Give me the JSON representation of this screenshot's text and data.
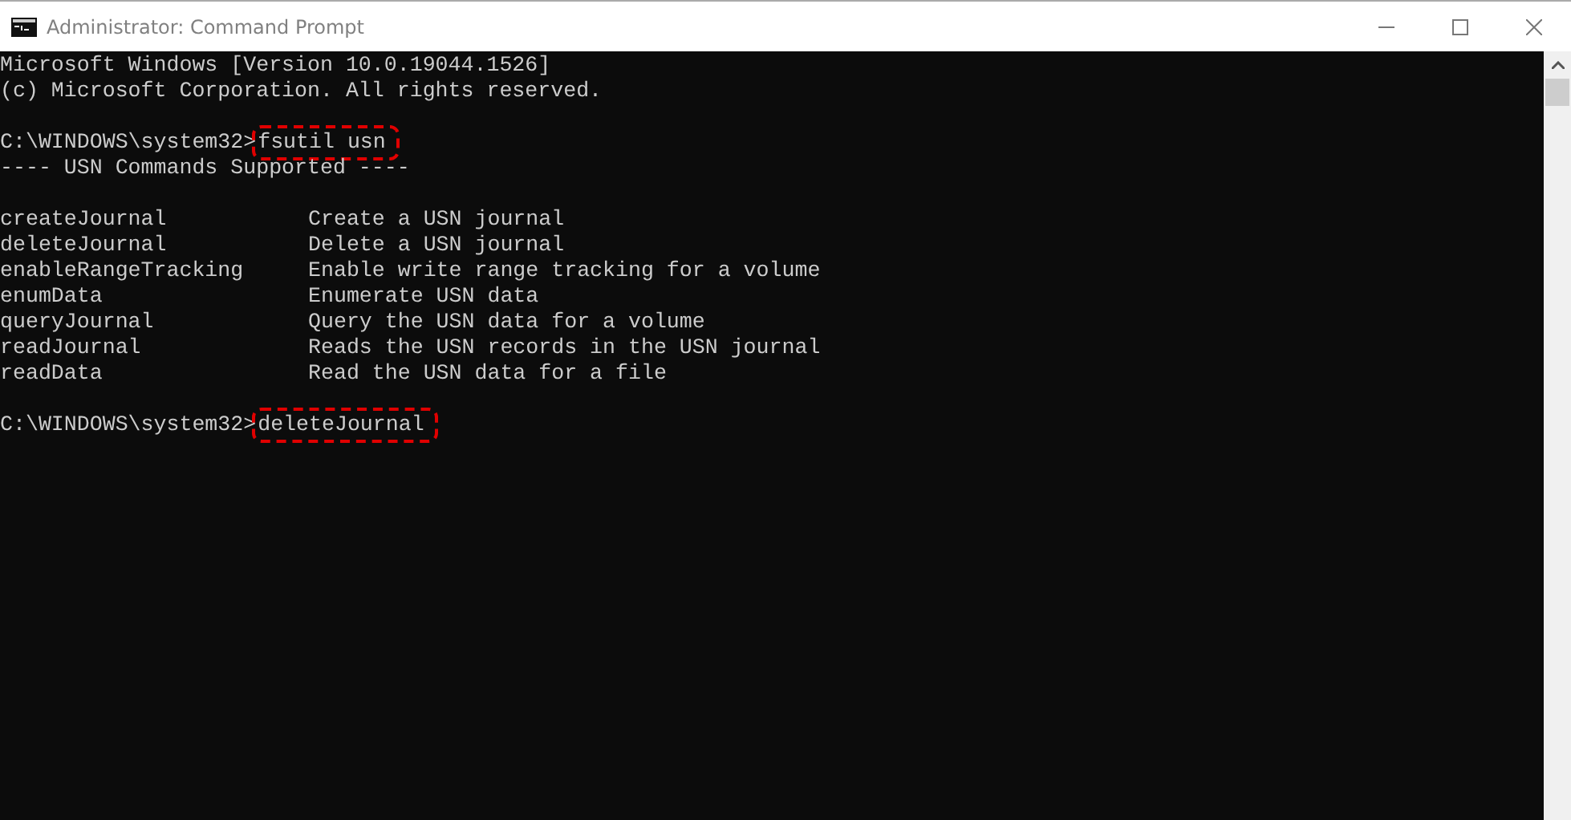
{
  "window": {
    "title": "Administrator: Command Prompt"
  },
  "console": {
    "lines": [
      {
        "kind": "text",
        "text": "Microsoft Windows [Version 10.0.19044.1526]"
      },
      {
        "kind": "text",
        "text": "(c) Microsoft Corporation. All rights reserved."
      },
      {
        "kind": "blank"
      },
      {
        "kind": "prompt",
        "prompt": "C:\\WINDOWS\\system32>",
        "command": "fsutil usn",
        "highlighted": true
      },
      {
        "kind": "text",
        "text": "---- USN Commands Supported ----"
      },
      {
        "kind": "blank"
      },
      {
        "kind": "row",
        "name": "createJournal",
        "description": "Create a USN journal"
      },
      {
        "kind": "row",
        "name": "deleteJournal",
        "description": "Delete a USN journal"
      },
      {
        "kind": "row",
        "name": "enableRangeTracking",
        "description": "Enable write range tracking for a volume"
      },
      {
        "kind": "row",
        "name": "enumData",
        "description": "Enumerate USN data"
      },
      {
        "kind": "row",
        "name": "queryJournal",
        "description": "Query the USN data for a volume"
      },
      {
        "kind": "row",
        "name": "readJournal",
        "description": "Reads the USN records in the USN journal"
      },
      {
        "kind": "row",
        "name": "readData",
        "description": "Read the USN data for a file"
      },
      {
        "kind": "blank"
      },
      {
        "kind": "prompt",
        "prompt": "C:\\WINDOWS\\system32>",
        "command": "deleteJournal",
        "highlighted": true
      }
    ]
  }
}
